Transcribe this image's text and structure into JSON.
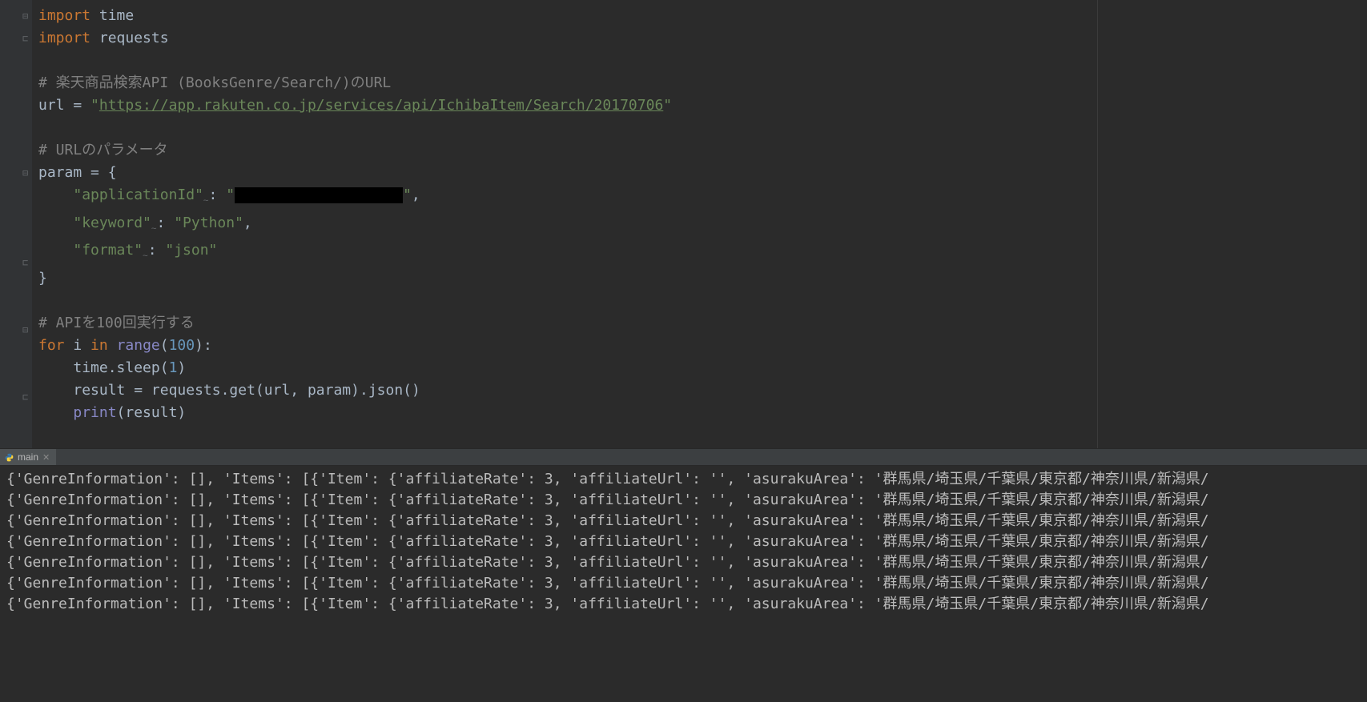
{
  "editor": {
    "lines": [
      {
        "type": "code",
        "fold": "open",
        "tokens": [
          {
            "cls": "kw",
            "t": "import "
          },
          {
            "cls": "ident",
            "t": "time"
          }
        ]
      },
      {
        "type": "code",
        "fold": "close",
        "tokens": [
          {
            "cls": "kw",
            "t": "import "
          },
          {
            "cls": "ident",
            "t": "requests"
          }
        ]
      },
      {
        "type": "blank"
      },
      {
        "type": "code",
        "tokens": [
          {
            "cls": "cmt",
            "t": "# 楽天商品検索API (BooksGenre/Search/)のURL"
          }
        ]
      },
      {
        "type": "code",
        "tokens": [
          {
            "cls": "ident",
            "t": "url = "
          },
          {
            "cls": "str",
            "t": "\""
          },
          {
            "cls": "url",
            "t": "https://app.rakuten.co.jp/services/api/IchibaItem/Search/20170706"
          },
          {
            "cls": "str",
            "t": "\""
          }
        ]
      },
      {
        "type": "blank"
      },
      {
        "type": "code",
        "tokens": [
          {
            "cls": "cmt",
            "t": "# URLのパラメータ"
          }
        ]
      },
      {
        "type": "code",
        "fold": "open",
        "tokens": [
          {
            "cls": "ident",
            "t": "param = {"
          }
        ]
      },
      {
        "type": "code",
        "indent": "    ",
        "tokens": [
          {
            "cls": "str",
            "t": "\"applicationId\""
          },
          {
            "cls": "typo",
            "t": "~"
          },
          {
            "cls": "ident",
            "t": ": "
          },
          {
            "cls": "str",
            "t": "\""
          },
          {
            "cls": "redact",
            "t": ""
          },
          {
            "cls": "str",
            "t": "\""
          },
          {
            "cls": "ident",
            "t": ","
          }
        ]
      },
      {
        "type": "code",
        "indent": "    ",
        "tokens": [
          {
            "cls": "str",
            "t": "\"keyword\""
          },
          {
            "cls": "typo",
            "t": "~"
          },
          {
            "cls": "ident",
            "t": ": "
          },
          {
            "cls": "str",
            "t": "\"Python\""
          },
          {
            "cls": "ident",
            "t": ","
          }
        ]
      },
      {
        "type": "code",
        "indent": "    ",
        "tokens": [
          {
            "cls": "str",
            "t": "\"format\""
          },
          {
            "cls": "typo",
            "t": "~"
          },
          {
            "cls": "ident",
            "t": ": "
          },
          {
            "cls": "str",
            "t": "\"json\""
          }
        ]
      },
      {
        "type": "code",
        "fold": "close",
        "tokens": [
          {
            "cls": "ident",
            "t": "}"
          }
        ]
      },
      {
        "type": "blank"
      },
      {
        "type": "code",
        "tokens": [
          {
            "cls": "cmt",
            "t": "# APIを100回実行する"
          }
        ]
      },
      {
        "type": "code",
        "fold": "open",
        "tokens": [
          {
            "cls": "kw",
            "t": "for "
          },
          {
            "cls": "ident",
            "t": "i "
          },
          {
            "cls": "kw",
            "t": "in "
          },
          {
            "cls": "builtin",
            "t": "range"
          },
          {
            "cls": "ident",
            "t": "("
          },
          {
            "cls": "num",
            "t": "100"
          },
          {
            "cls": "ident",
            "t": "):"
          }
        ]
      },
      {
        "type": "code",
        "indent": "    ",
        "tokens": [
          {
            "cls": "ident",
            "t": "time.sleep("
          },
          {
            "cls": "num",
            "t": "1"
          },
          {
            "cls": "ident",
            "t": ")"
          }
        ]
      },
      {
        "type": "code",
        "indent": "    ",
        "tokens": [
          {
            "cls": "ident",
            "t": "result = requests.get(url, param).json()"
          }
        ]
      },
      {
        "type": "code",
        "fold": "close",
        "indent": "    ",
        "tokens": [
          {
            "cls": "builtin",
            "t": "print"
          },
          {
            "cls": "ident",
            "t": "(result)"
          }
        ]
      },
      {
        "type": "blank"
      }
    ]
  },
  "runTab": {
    "label": "main"
  },
  "console": {
    "line": "{'GenreInformation': [], 'Items': [{'Item': {'affiliateRate': 3, 'affiliateUrl': '', 'asurakuArea': '群馬県/埼玉県/千葉県/東京都/神奈川県/新潟県/",
    "repeat": 7
  }
}
